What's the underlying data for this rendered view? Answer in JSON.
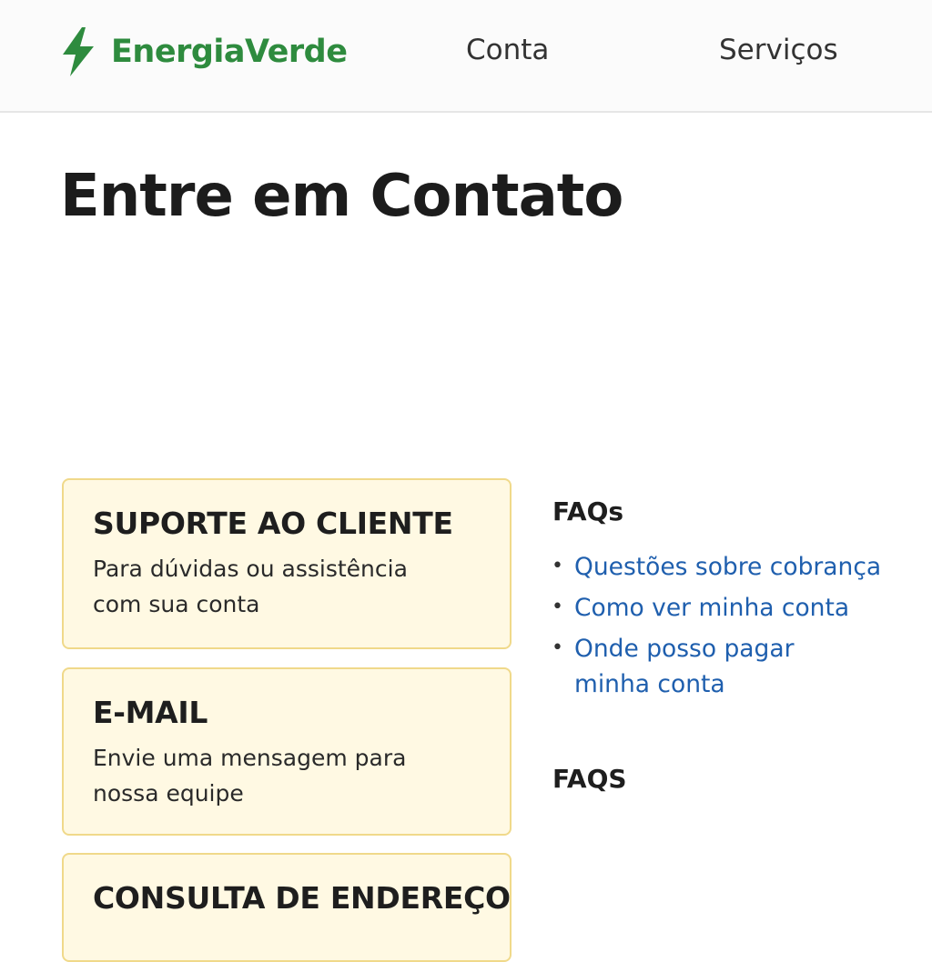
{
  "header": {
    "brand": "EnergiaVerde",
    "nav": [
      {
        "label": "Conta"
      },
      {
        "label": "Serviços"
      }
    ]
  },
  "main": {
    "title": "Entre em Contato",
    "cards": [
      {
        "title": "SUPORTE AO CLIENTE",
        "description": "Para dúvidas ou assistência com sua conta"
      },
      {
        "title": "E-MAIL",
        "description": "Envie uma mensagem para nossa equipe"
      },
      {
        "title": "CONSULTA DE ENDEREÇO",
        "description": ""
      }
    ]
  },
  "sidebar": {
    "faq_heading": "FAQs",
    "faq_links": [
      {
        "label": "Questões sobre cobrança"
      },
      {
        "label": "Como ver minha conta"
      },
      {
        "label": "Onde posso pagar minha conta"
      }
    ],
    "faq_heading_2": "FAQS"
  },
  "colors": {
    "brand": "#2e8b3e",
    "card_background": "#fff9e3",
    "card_border": "#f0d98a",
    "link": "#1f5fae"
  },
  "icons": {
    "logo": "lightning-bolt-icon",
    "bullet": "bullet-icon"
  }
}
